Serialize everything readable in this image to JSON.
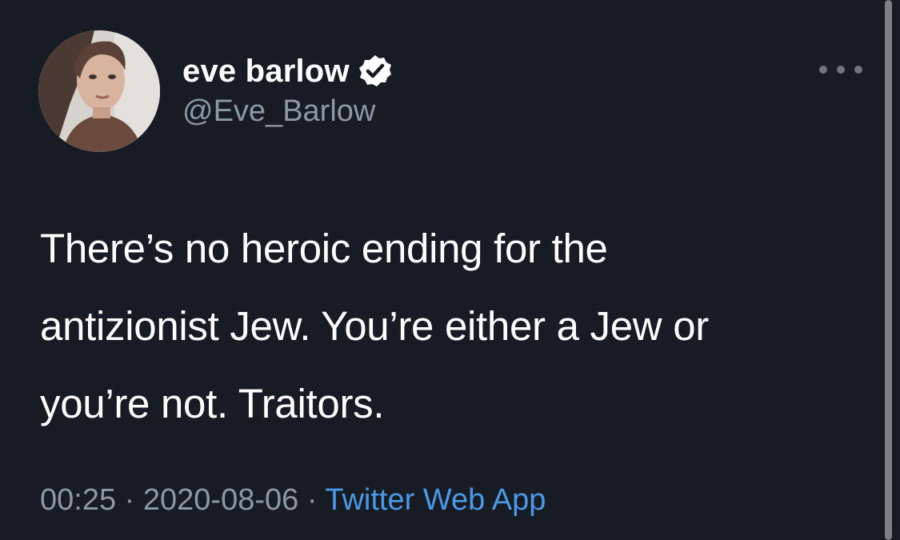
{
  "author": {
    "display_name": "eve barlow",
    "handle": "@Eve_Barlow",
    "verified": true
  },
  "tweet": {
    "text_lines": [
      "There’s no heroic ending for the",
      "antizionist Jew. You’re either a Jew or",
      "you’re not. Traitors."
    ]
  },
  "meta": {
    "time": "00:25",
    "separator": "·",
    "date": "2020-08-06",
    "source": "Twitter Web App"
  },
  "icons": {
    "verified": "verified-badge-icon",
    "more": "more-horizontal-icon"
  },
  "colors": {
    "background": "#161b24",
    "text": "#ffffff",
    "secondary": "#8b98a5",
    "link": "#4b98e7"
  }
}
